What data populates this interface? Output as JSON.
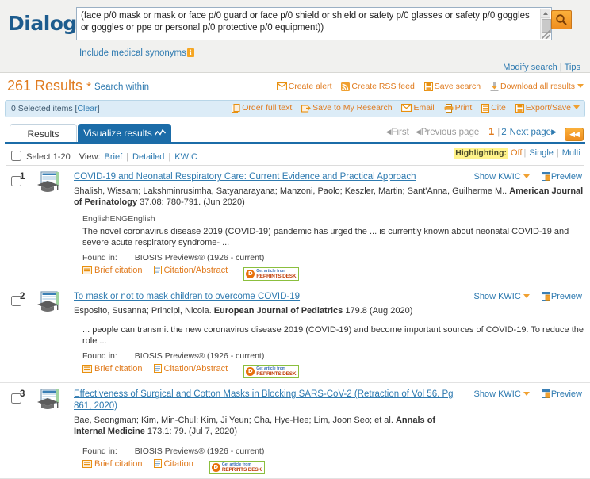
{
  "brand": {
    "name": "Dialog",
    "dot": "."
  },
  "search": {
    "query": "(face p/0 mask or mask or face p/0 guard or face p/0 shield or shield or safety p/0 glasses or safety p/0 goggles or goggles or ppe or personal p/0 protective p/0 equipment))",
    "clipped_top_line": "(face p/0 mask or mask or face p/0 guard or face p/0 shield or shield or safety p/0 glasses or",
    "search_button_icon": "search-icon",
    "synonyms_label": "Include medical synonyms",
    "info_badge": "i",
    "modify_search": "Modify search",
    "tips": "Tips",
    "separator": "|"
  },
  "results_header": {
    "count": "261 Results",
    "asterisk": "*",
    "search_within": "Search within",
    "actions": [
      {
        "label": "Create alert",
        "icon": "envelope-icon"
      },
      {
        "label": "Create RSS feed",
        "icon": "rss-icon"
      },
      {
        "label": "Save search",
        "icon": "floppy-disk-icon"
      },
      {
        "label": "Download all results",
        "icon": "download-icon",
        "caret": true
      }
    ]
  },
  "selected_bar": {
    "text": "0 Selected items",
    "clear_open": "[",
    "clear": "Clear",
    "clear_close": "]",
    "actions": [
      {
        "label": "Order full text",
        "icon": "order-fulltext-icon"
      },
      {
        "label": "Save to My Research",
        "icon": "save-research-icon"
      },
      {
        "label": "Email",
        "icon": "email-icon"
      },
      {
        "label": "Print",
        "icon": "printer-icon"
      },
      {
        "label": "Cite",
        "icon": "cite-icon"
      },
      {
        "label": "Export/Save",
        "icon": "export-save-icon",
        "caret": true
      }
    ]
  },
  "tabs": {
    "results": "Results",
    "visualize": "Visualize results",
    "visualize_icon": "sparkline-icon"
  },
  "pager": {
    "first": "First",
    "previous": "Previous page",
    "page_current": "1",
    "pipe": "|",
    "page_next_num": "2",
    "next": "Next page",
    "rewind_icon": "rewind-icon",
    "rewind_label": "◀◀"
  },
  "view_row": {
    "select_all": "Select 1-20",
    "view_label": "View:",
    "view_options": [
      "Brief",
      "Detailed",
      "KWIC"
    ],
    "highlighting_label": "Highlighting:",
    "highlighting_options": [
      "Off",
      "Single",
      "Multi"
    ],
    "pipe": "|"
  },
  "common": {
    "show_kwic": "Show KWIC",
    "preview": "Preview",
    "found_in_label": "Found in:",
    "reprints_line1": "Get article from",
    "reprints_line2": "REPRINTS DESK",
    "reprints_mark": "D"
  },
  "results": [
    {
      "num": "1",
      "title": "COVID-19 and Neonatal Respiratory Care: Current Evidence and Practical Approach",
      "authors": "Shalish, Wissam; Lakshminrusimha, Satyanarayana; Manzoni, Paolo; Keszler, Martin; Sant'Anna, Guilherme M.. ",
      "journal": "American Journal of Perinatology",
      "citation": " 37.08: 780-791. (Jun 2020)",
      "language": "EnglishENGEnglish",
      "snippet": "The novel coronavirus disease 2019 (COVID-19) pandemic has urged the ... is currently known about neonatal COVID-19 and severe acute respiratory syndrome- ...",
      "found_in": "BIOSIS Previews® (1926 - current)",
      "links": [
        "Brief citation",
        "Citation/Abstract"
      ],
      "has_reprints": true,
      "show_kwic": "Show KWIC",
      "preview": "Preview"
    },
    {
      "num": "2",
      "title": "To mask or not to mask children to overcome COVID-19",
      "authors": "Esposito, Susanna; Principi, Nicola. ",
      "journal": "European Journal of Pediatrics",
      "citation": " 179.8 (Aug 2020)",
      "language": "",
      "snippet": "... people can transmit the new coronavirus disease 2019 (COVID-19) and become important sources of COVID-19. To reduce the role ...",
      "found_in": "BIOSIS Previews® (1926 - current)",
      "links": [
        "Brief citation",
        "Citation/Abstract"
      ],
      "has_reprints": true,
      "show_kwic": "Show KWIC",
      "preview": "Preview"
    },
    {
      "num": "3",
      "title": "Effectiveness of Surgical and Cotton Masks in Blocking SARS-CoV-2 (Retraction of Vol 56, Pg 861, 2020)",
      "authors": "Bae, Seongman; Kim, Min-Chul; Kim, Ji Yeun; Cha, Hye-Hee; Lim, Joon Seo; et al. ",
      "journal": "Annals of Internal Medicine",
      "citation": " 173.1: 79. (Jul 7, 2020)",
      "language": "",
      "snippet": "",
      "found_in": "BIOSIS Previews® (1926 - current)",
      "links": [
        "Brief citation",
        "Citation"
      ],
      "has_reprints": true,
      "show_kwic": "Show KWIC",
      "preview": "Preview"
    }
  ],
  "colors": {
    "accent_orange": "#e07b1f",
    "link_blue": "#2e7ab0",
    "tab_blue": "#1b6ca8",
    "highlight_yellow": "#fff38a"
  }
}
